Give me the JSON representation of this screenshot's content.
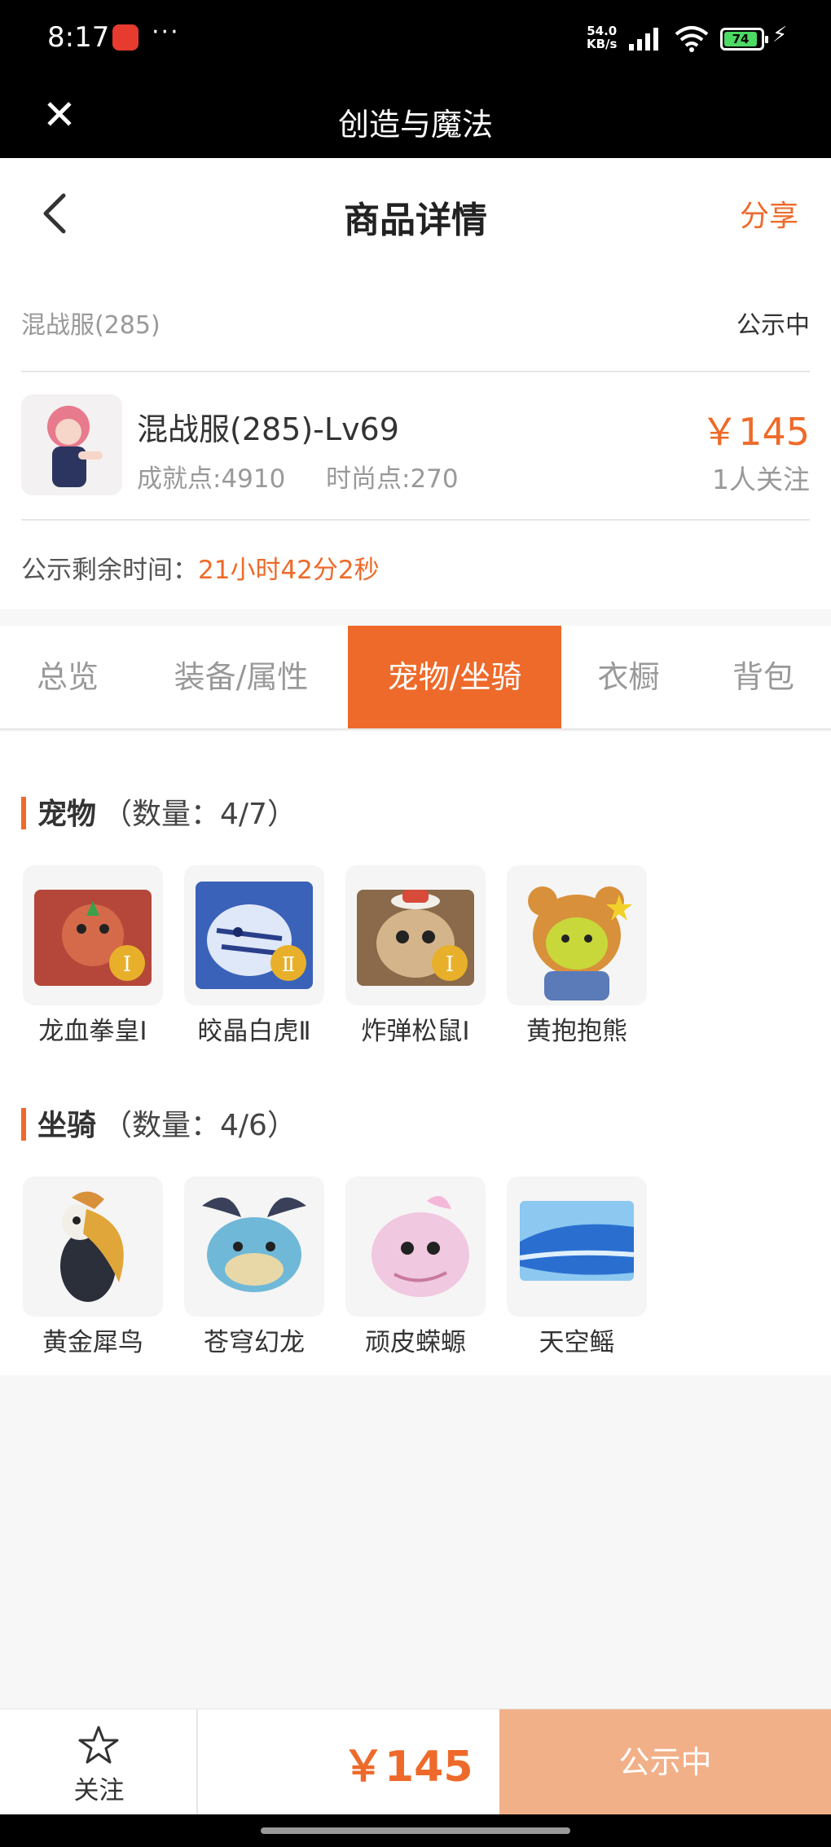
{
  "status_bar": {
    "time": "8:17",
    "more": "···",
    "net_speed_value": "54.0",
    "net_speed_unit": "KB/s",
    "battery": "74"
  },
  "app_bar": {
    "title": "创造与魔法",
    "close_icon": "close-icon"
  },
  "header": {
    "title": "商品详情",
    "share": "分享",
    "back_icon": "chevron-left-icon"
  },
  "item": {
    "server": "混战服(285)",
    "status": "公示中",
    "name": "混战服(285)-Lv69",
    "achievement": "成就点:4910",
    "fashion": "时尚点:270",
    "price": "￥145",
    "followers": "1人关注",
    "remaining_label": "公示剩余时间：",
    "remaining_value": "21小时42分2秒"
  },
  "tabs": [
    {
      "label": "总览"
    },
    {
      "label": "装备/属性"
    },
    {
      "label": "宠物/坐骑",
      "active": true
    },
    {
      "label": "衣橱"
    },
    {
      "label": "背包"
    }
  ],
  "pets": {
    "title": "宠物",
    "count": "（数量：4/7）",
    "items": [
      {
        "name": "龙血拳皇Ⅰ",
        "color": "#b5473a",
        "badge": "Ⅰ"
      },
      {
        "name": "皎晶白虎Ⅱ",
        "color": "#4f7bd0",
        "badge": "Ⅱ"
      },
      {
        "name": "炸弹松鼠Ⅰ",
        "color": "#b58a5a",
        "badge": "Ⅰ"
      },
      {
        "name": "黄抱抱熊",
        "color": "#d8903a",
        "badge": ""
      }
    ]
  },
  "mounts": {
    "title": "坐骑",
    "count": "（数量：4/6）",
    "items": [
      {
        "name": "黄金犀鸟",
        "color": "#e0a63a"
      },
      {
        "name": "苍穹幻龙",
        "color": "#6fb8d8"
      },
      {
        "name": "顽皮蝾螈",
        "color": "#f0b8d8"
      },
      {
        "name": "天空鳐",
        "color": "#4a9de0"
      }
    ]
  },
  "bottom_bar": {
    "follow": "关注",
    "price": "￥145",
    "action": "公示中"
  },
  "colors": {
    "accent": "#ee6a2a",
    "action_bg": "#f2b088"
  }
}
